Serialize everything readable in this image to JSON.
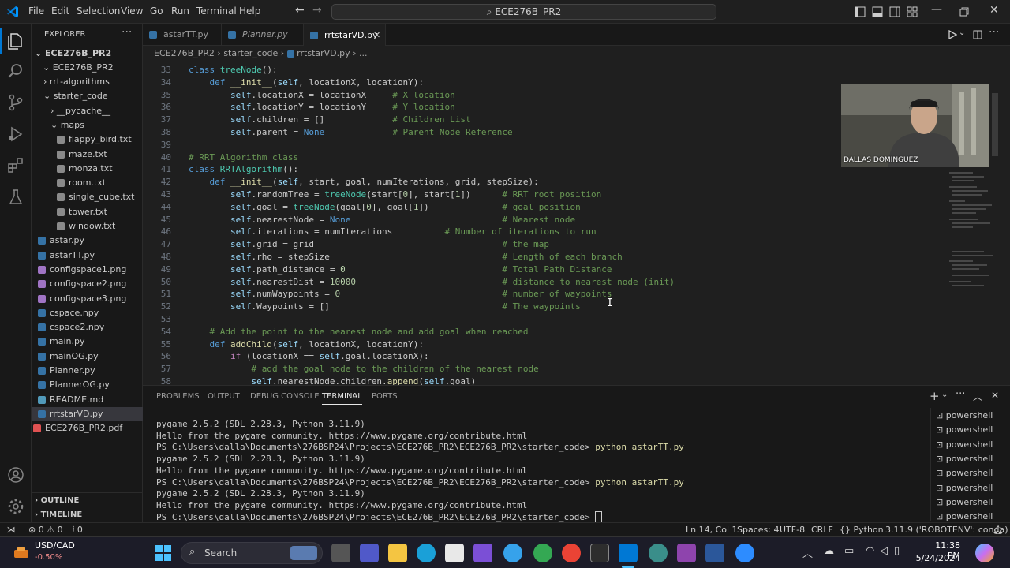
{
  "menu": [
    "File",
    "Edit",
    "Selection",
    "View",
    "Go",
    "Run",
    "Terminal",
    "Help"
  ],
  "command_center": "ECE276B_PR2",
  "explorer": {
    "title": "EXPLORER",
    "root": "ECE276B_PR2",
    "folder": "ECE276B_PR2",
    "items": [
      {
        "label": "rrt-algorithms",
        "type": "folder"
      },
      {
        "label": "starter_code",
        "type": "folder"
      },
      {
        "label": "__pycache__",
        "type": "folder"
      },
      {
        "label": "maps",
        "type": "folder"
      },
      {
        "label": "flappy_bird.txt",
        "type": "txt"
      },
      {
        "label": "maze.txt",
        "type": "txt"
      },
      {
        "label": "monza.txt",
        "type": "txt"
      },
      {
        "label": "room.txt",
        "type": "txt"
      },
      {
        "label": "single_cube.txt",
        "type": "txt"
      },
      {
        "label": "tower.txt",
        "type": "txt"
      },
      {
        "label": "window.txt",
        "type": "txt"
      },
      {
        "label": "astar.py",
        "type": "py"
      },
      {
        "label": "astarTT.py",
        "type": "py"
      },
      {
        "label": "configspace1.png",
        "type": "png"
      },
      {
        "label": "configspace2.png",
        "type": "png"
      },
      {
        "label": "configspace3.png",
        "type": "png"
      },
      {
        "label": "cspace.npy",
        "type": "npy"
      },
      {
        "label": "cspace2.npy",
        "type": "npy"
      },
      {
        "label": "main.py",
        "type": "py"
      },
      {
        "label": "mainOG.py",
        "type": "py"
      },
      {
        "label": "Planner.py",
        "type": "py"
      },
      {
        "label": "PlannerOG.py",
        "type": "py"
      },
      {
        "label": "README.md",
        "type": "md"
      },
      {
        "label": "rrtstarVD.py",
        "type": "py"
      },
      {
        "label": "ECE276B_PR2.pdf",
        "type": "pdf"
      }
    ],
    "outline": "OUTLINE",
    "timeline": "TIMELINE"
  },
  "tabs": [
    {
      "label": "astarTT.py"
    },
    {
      "label": "Planner.py"
    },
    {
      "label": "rrtstarVD.py"
    }
  ],
  "breadcrumb": [
    "ECE276B_PR2",
    "starter_code",
    "rrtstarVD.py",
    "..."
  ],
  "code_lines": [
    {
      "n": "33",
      "t": "class treeNode():"
    },
    {
      "n": "34",
      "t": "    def __init__(self, locationX, locationY):"
    },
    {
      "n": "35",
      "t": "        self.locationX = locationX     # X location"
    },
    {
      "n": "36",
      "t": "        self.locationY = locationY     # Y location"
    },
    {
      "n": "37",
      "t": "        self.children = []             # Children List"
    },
    {
      "n": "38",
      "t": "        self.parent = None             # Parent Node Reference"
    },
    {
      "n": "39",
      "t": ""
    },
    {
      "n": "40",
      "t": "# RRT Algorithm class"
    },
    {
      "n": "41",
      "t": "class RRTAlgorithm():"
    },
    {
      "n": "42",
      "t": "    def __init__(self, start, goal, numIterations, grid, stepSize):"
    },
    {
      "n": "43",
      "t": "        self.randomTree = treeNode(start[0], start[1])      # RRT root position"
    },
    {
      "n": "44",
      "t": "        self.goal = treeNode(goal[0], goal[1])              # goal position"
    },
    {
      "n": "45",
      "t": "        self.nearestNode = None                             # Nearest node"
    },
    {
      "n": "46",
      "t": "        self.iterations = numIterations          # Number of iterations to run"
    },
    {
      "n": "47",
      "t": "        self.grid = grid                                    # the map"
    },
    {
      "n": "48",
      "t": "        self.rho = stepSize                                 # Length of each branch"
    },
    {
      "n": "49",
      "t": "        self.path_distance = 0                              # Total Path Distance"
    },
    {
      "n": "50",
      "t": "        self.nearestDist = 10000                            # distance to nearest node (init)"
    },
    {
      "n": "51",
      "t": "        self.numWaypoints = 0                               # number of waypoints"
    },
    {
      "n": "52",
      "t": "        self.Waypoints = []                                 # The waypoints"
    },
    {
      "n": "53",
      "t": ""
    },
    {
      "n": "54",
      "t": "    # Add the point to the nearest node and add goal when reached"
    },
    {
      "n": "55",
      "t": "    def addChild(self, locationX, locationY):"
    },
    {
      "n": "56",
      "t": "        if (locationX == self.goal.locationX):"
    },
    {
      "n": "57",
      "t": "            # add the goal node to the children of the nearest node"
    },
    {
      "n": "58",
      "t": "            self.nearestNode.children.append(self.goal)"
    }
  ],
  "webcam_name": "DALLAS DOMINGUEZ",
  "panel_tabs": [
    "PROBLEMS",
    "OUTPUT",
    "DEBUG CONSOLE",
    "TERMINAL",
    "PORTS"
  ],
  "terminal_lines": [
    {
      "text": "pygame 2.5.2 (SDL 2.28.3, Python 3.11.9)",
      "cmd": ""
    },
    {
      "text": "Hello from the pygame community. https://www.pygame.org/contribute.html",
      "cmd": ""
    },
    {
      "text": "PS C:\\Users\\dalla\\Documents\\276BSP24\\Projects\\ECE276B_PR2\\ECE276B_PR2\\starter_code> ",
      "cmd": "python astarTT.py"
    },
    {
      "text": "pygame 2.5.2 (SDL 2.28.3, Python 3.11.9)",
      "cmd": ""
    },
    {
      "text": "Hello from the pygame community. https://www.pygame.org/contribute.html",
      "cmd": ""
    },
    {
      "text": "PS C:\\Users\\dalla\\Documents\\276BSP24\\Projects\\ECE276B_PR2\\ECE276B_PR2\\starter_code> ",
      "cmd": "python astarTT.py"
    },
    {
      "text": "pygame 2.5.2 (SDL 2.28.3, Python 3.11.9)",
      "cmd": ""
    },
    {
      "text": "Hello from the pygame community. https://www.pygame.org/contribute.html",
      "cmd": ""
    },
    {
      "text": "PS C:\\Users\\dalla\\Documents\\276BSP24\\Projects\\ECE276B_PR2\\ECE276B_PR2\\starter_code> ",
      "cmd": ""
    }
  ],
  "shell_list": [
    "powershell",
    "powershell",
    "powershell",
    "powershell",
    "powershell",
    "powershell",
    "powershell",
    "powershell",
    "powershell"
  ],
  "status": {
    "errors": "0",
    "warnings": "0",
    "ports": "0",
    "position": "Ln 14, Col 1",
    "spaces": "Spaces: 4",
    "encoding": "UTF-8",
    "eol": "CRLF",
    "language": "Python",
    "interpreter": "3.11.9 ('ROBOTENV': conda)"
  },
  "taskbar": {
    "ticker": "USD/CAD",
    "change": "-0.50%",
    "search_placeholder": "Search",
    "time": "11:38 PM",
    "date": "5/24/2024"
  }
}
